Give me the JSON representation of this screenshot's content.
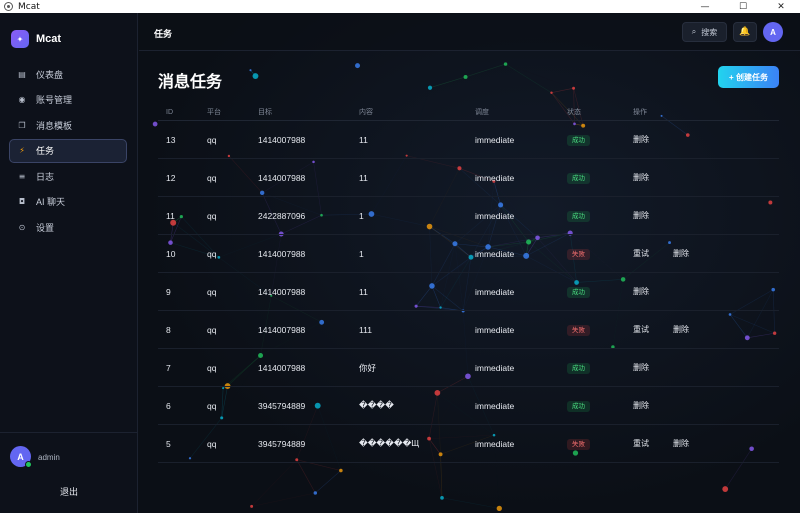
{
  "window": {
    "title": "Mcat",
    "controls": {
      "minimize": "—",
      "maximize": "☐",
      "close": "✕"
    }
  },
  "sidebar": {
    "brand": "Mcat",
    "items": [
      {
        "label": "仪表盘",
        "icon": "dashboard-icon",
        "glyph": "▤",
        "active": false
      },
      {
        "label": "账号管理",
        "icon": "account-icon",
        "glyph": "◉",
        "active": false
      },
      {
        "label": "消息模板",
        "icon": "template-icon",
        "glyph": "❐",
        "active": false
      },
      {
        "label": "任务",
        "icon": "lightning-icon",
        "glyph": "⚡",
        "active": true
      },
      {
        "label": "日志",
        "icon": "log-icon",
        "glyph": "≡",
        "active": false
      },
      {
        "label": "AI 聊天",
        "icon": "robot-icon",
        "glyph": "◘",
        "active": false
      },
      {
        "label": "设置",
        "icon": "gear-icon",
        "glyph": "⊙",
        "active": false
      }
    ],
    "user": {
      "avatar_letter": "A",
      "name": "admin"
    },
    "logout_label": "退出"
  },
  "header": {
    "title": "任务",
    "search_label": "搜索",
    "avatar_letter": "A"
  },
  "page": {
    "title": "消息任务",
    "create_label": "+ 创建任务"
  },
  "table": {
    "columns": [
      "ID",
      "平台",
      "目标",
      "内容",
      "调度",
      "状态",
      "操作"
    ],
    "rows": [
      {
        "id": "13",
        "platform": "qq",
        "target": "1414007988",
        "content": "11",
        "schedule": "immediate",
        "status": "成功",
        "ok": true,
        "ops": [
          "删除"
        ]
      },
      {
        "id": "12",
        "platform": "qq",
        "target": "1414007988",
        "content": "11",
        "schedule": "immediate",
        "status": "成功",
        "ok": true,
        "ops": [
          "删除"
        ]
      },
      {
        "id": "11",
        "platform": "qq",
        "target": "2422887096",
        "content": "1",
        "schedule": "immediate",
        "status": "成功",
        "ok": true,
        "ops": [
          "删除"
        ]
      },
      {
        "id": "10",
        "platform": "qq",
        "target": "1414007988",
        "content": "1",
        "schedule": "immediate",
        "status": "失败",
        "ok": false,
        "ops": [
          "重试",
          "删除"
        ]
      },
      {
        "id": "9",
        "platform": "qq",
        "target": "1414007988",
        "content": "11",
        "schedule": "immediate",
        "status": "成功",
        "ok": true,
        "ops": [
          "删除"
        ]
      },
      {
        "id": "8",
        "platform": "qq",
        "target": "1414007988",
        "content": "111",
        "schedule": "immediate",
        "status": "失败",
        "ok": false,
        "ops": [
          "重试",
          "删除"
        ]
      },
      {
        "id": "7",
        "platform": "qq",
        "target": "1414007988",
        "content": "你好",
        "schedule": "immediate",
        "status": "成功",
        "ok": true,
        "ops": [
          "删除"
        ]
      },
      {
        "id": "6",
        "platform": "qq",
        "target": "3945794889",
        "content": "����",
        "schedule": "immediate",
        "status": "成功",
        "ok": true,
        "ops": [
          "删除"
        ]
      },
      {
        "id": "5",
        "platform": "qq",
        "target": "3945794889",
        "content": "������Щ",
        "schedule": "immediate",
        "status": "失败",
        "ok": false,
        "ops": [
          "重试",
          "删除"
        ]
      }
    ]
  },
  "colors": {
    "accent": "#6366f1",
    "success": "#4ade80",
    "fail": "#f87171",
    "active_icon": "#f59e0b"
  }
}
